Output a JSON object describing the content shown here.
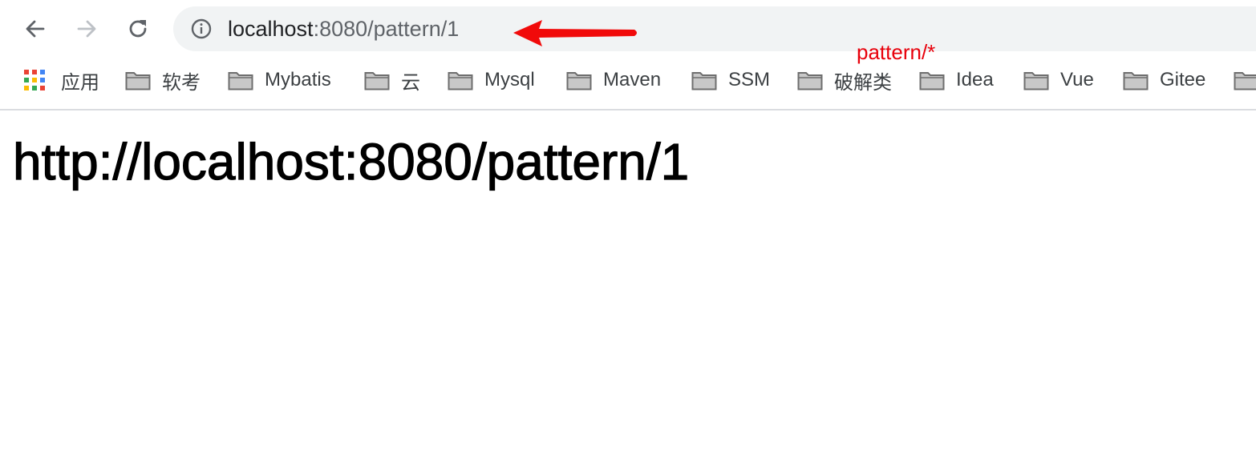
{
  "address_bar": {
    "url_host": "localhost",
    "url_rest": ":8080/pattern/1"
  },
  "annotation": {
    "label": "pattern/*",
    "color": "#e8000b"
  },
  "bookmarks": [
    {
      "label": "应用",
      "icon": "apps-grid-icon"
    },
    {
      "label": "软考",
      "icon": "folder-icon"
    },
    {
      "label": "Mybatis",
      "icon": "folder-icon"
    },
    {
      "label": "云",
      "icon": "folder-icon"
    },
    {
      "label": "Mysql",
      "icon": "folder-icon"
    },
    {
      "label": "Maven",
      "icon": "folder-icon"
    },
    {
      "label": "SSM",
      "icon": "folder-icon"
    },
    {
      "label": "破解类",
      "icon": "folder-icon"
    },
    {
      "label": "Idea",
      "icon": "folder-icon"
    },
    {
      "label": "Vue",
      "icon": "folder-icon"
    },
    {
      "label": "Gitee",
      "icon": "folder-icon"
    }
  ],
  "page": {
    "heading": "http://localhost:8080/pattern/1"
  },
  "colors": {
    "omnibox_bg": "#f1f3f4",
    "icon_gray": "#5f6368",
    "icon_disabled": "#bdc1c6"
  }
}
